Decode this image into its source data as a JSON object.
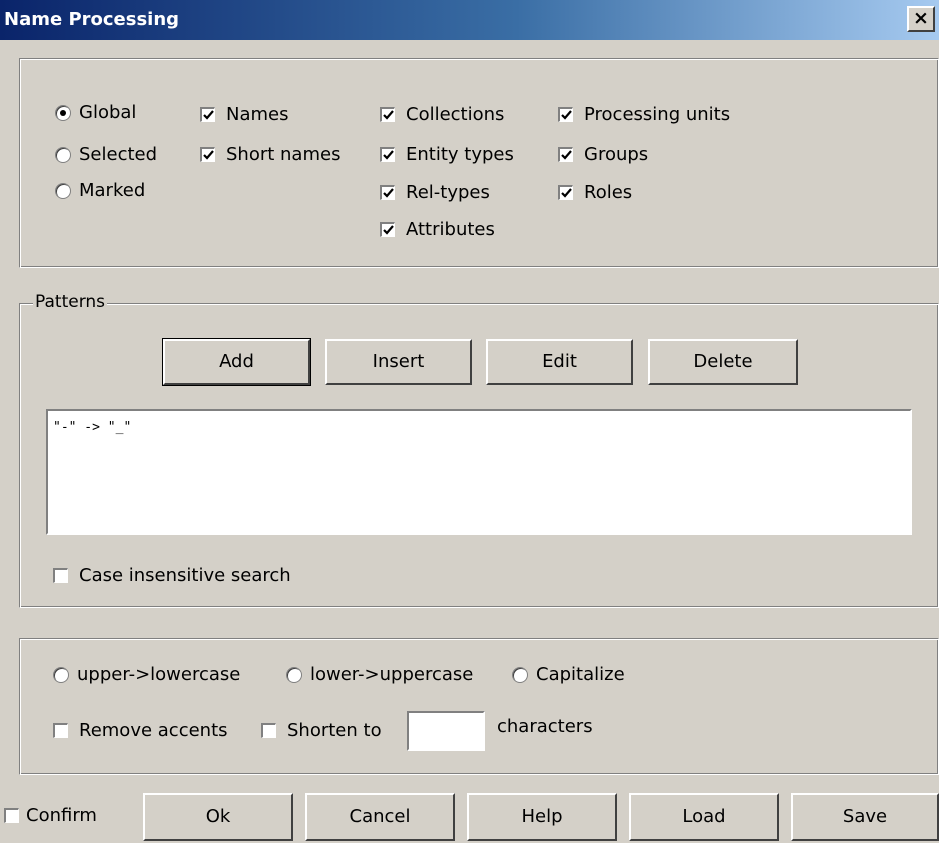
{
  "window": {
    "title": "Name Processing",
    "close_glyph": "×"
  },
  "scope": {
    "global": "Global",
    "selected": "Selected",
    "marked": "Marked",
    "names": "Names",
    "short_names": "Short names",
    "collections": "Collections",
    "entity_types": "Entity types",
    "rel_types": "Rel-types",
    "attributes": "Attributes",
    "processing_units": "Processing units",
    "groups": "Groups",
    "roles": "Roles"
  },
  "patterns": {
    "legend": "Patterns",
    "add": "Add",
    "insert": "Insert",
    "edit": "Edit",
    "delete": "Delete",
    "items": [
      "\"-\" -> \"_\""
    ],
    "case_insensitive": "Case insensitive search"
  },
  "transform": {
    "upper_lower": "upper->lowercase",
    "lower_upper": "lower->uppercase",
    "capitalize": "Capitalize",
    "remove_accents": "Remove accents",
    "shorten_to": "Shorten to",
    "shorten_value": "",
    "characters": "characters"
  },
  "footer": {
    "confirm": "Confirm",
    "ok": "Ok",
    "cancel": "Cancel",
    "help": "Help",
    "load": "Load",
    "save": "Save"
  }
}
